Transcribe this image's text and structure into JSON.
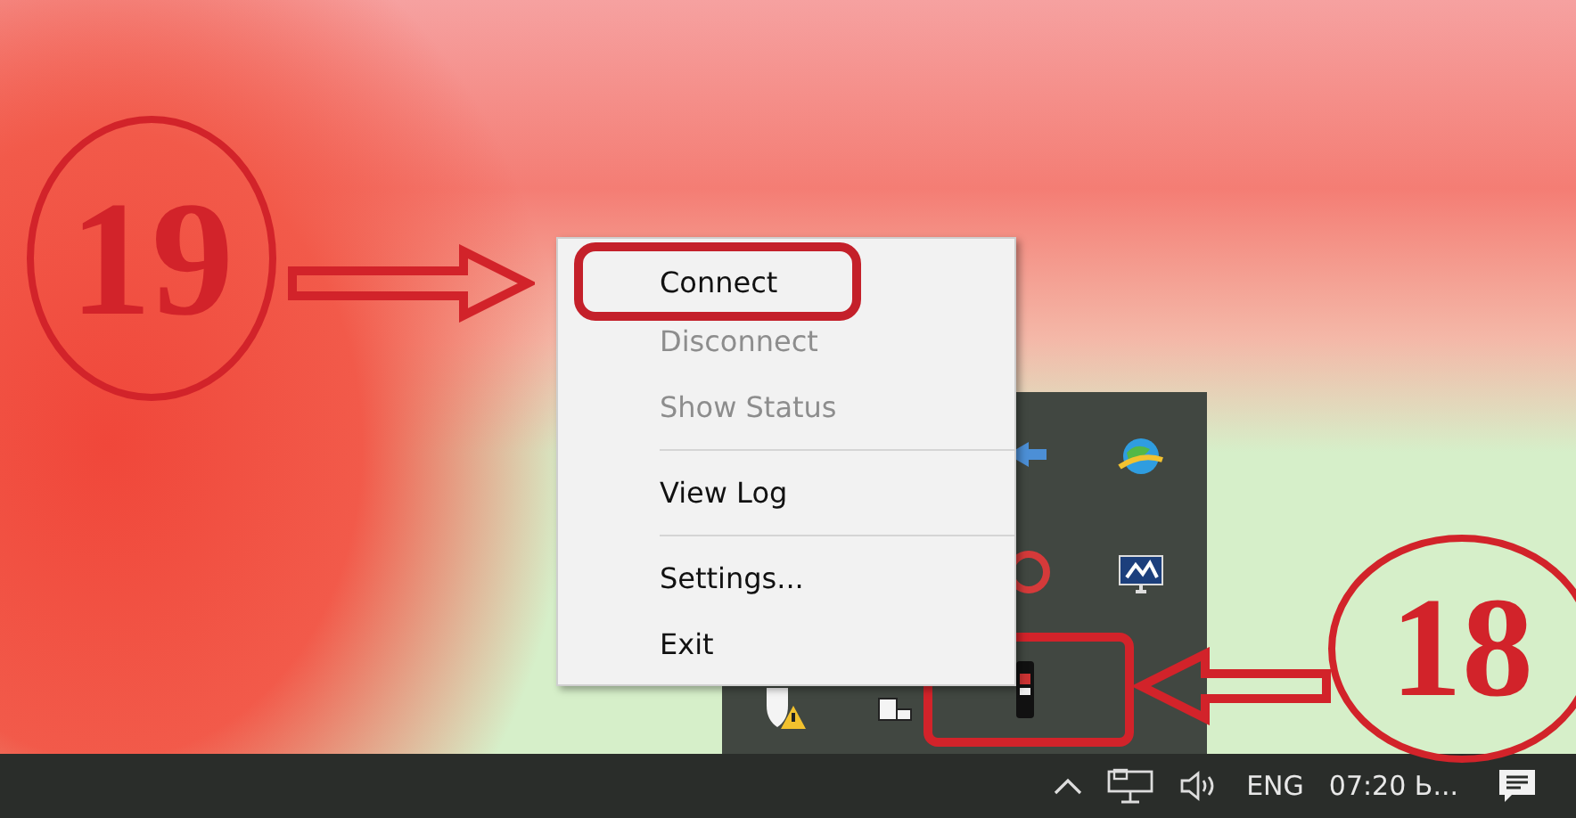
{
  "annotations": [
    {
      "kind": "step",
      "label": "19"
    },
    {
      "kind": "step",
      "label": "18"
    }
  ],
  "menu": {
    "items": [
      {
        "kind": "item",
        "label": "Connect",
        "disabled": false,
        "highlighted": true
      },
      {
        "kind": "item",
        "label": "Disconnect",
        "disabled": true,
        "highlighted": false
      },
      {
        "kind": "item",
        "label": "Show Status",
        "disabled": true,
        "highlighted": false
      },
      {
        "kind": "separator"
      },
      {
        "kind": "item",
        "label": "View Log",
        "disabled": false,
        "highlighted": false
      },
      {
        "kind": "separator"
      },
      {
        "kind": "item",
        "label": "Settings...",
        "disabled": false,
        "highlighted": false
      },
      {
        "kind": "item",
        "label": "Exit",
        "disabled": false,
        "highlighted": false
      }
    ]
  },
  "taskbar": {
    "language": "ENG",
    "clock": "07:20 Ь..."
  }
}
